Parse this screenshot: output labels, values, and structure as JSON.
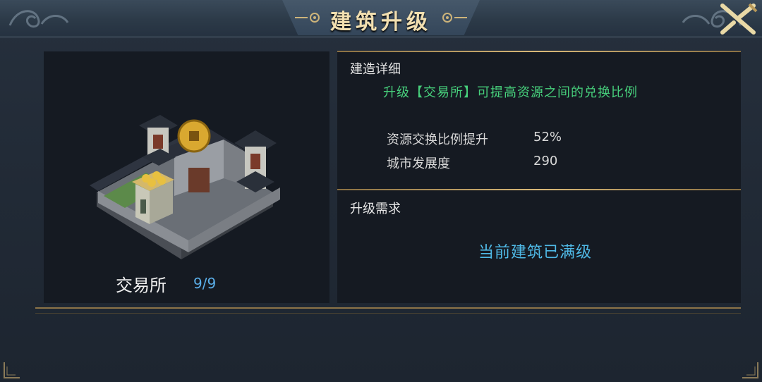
{
  "window": {
    "title": "建筑升级"
  },
  "building": {
    "name": "交易所",
    "level": "9/9"
  },
  "details": {
    "section_title": "建造详细",
    "description": "升级【交易所】可提高资源之间的兑换比例",
    "stats": [
      {
        "label": "资源交换比例提升",
        "value": "52%"
      },
      {
        "label": "城市发展度",
        "value": "290"
      }
    ]
  },
  "requirements": {
    "section_title": "升级需求",
    "status": "当前建筑已满级"
  },
  "colors": {
    "accent_gold": "#d8b878",
    "description_green": "#47d07c",
    "status_blue": "#4fb9e6",
    "level_blue": "#5aaee8"
  },
  "icons": {
    "close": "crossed-swords-close-icon",
    "building": "trading-post-building-icon"
  }
}
